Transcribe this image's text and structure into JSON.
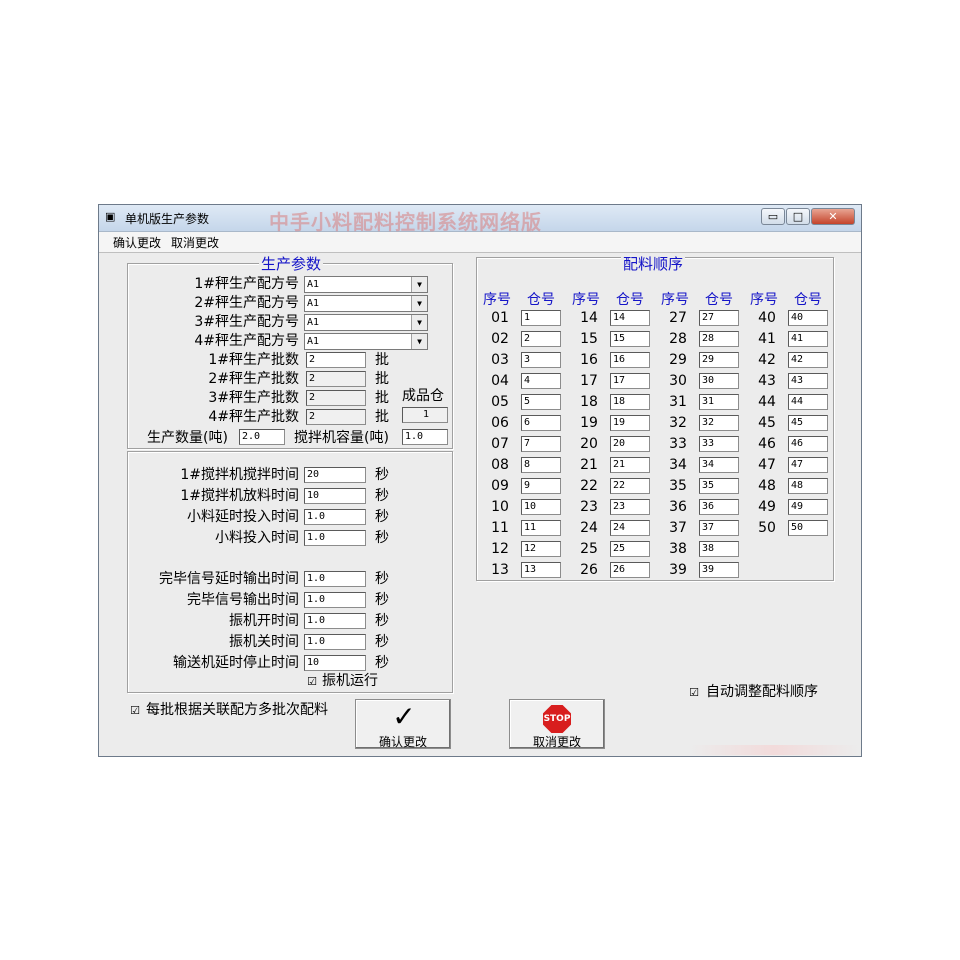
{
  "window": {
    "title": "单机版生产参数",
    "watermark": "中手小料配料控制系统网络版",
    "controls": {
      "minimize": "▭",
      "maximize": "□",
      "close": "✕"
    }
  },
  "menu": {
    "confirm": "确认更改",
    "cancel": "取消更改"
  },
  "production": {
    "title": "生产参数",
    "recipes": [
      {
        "label": "1#秤生产配方号",
        "value": "A1"
      },
      {
        "label": "2#秤生产配方号",
        "value": "A1"
      },
      {
        "label": "3#秤生产配方号",
        "value": "A1"
      },
      {
        "label": "4#秤生产配方号",
        "value": "A1"
      }
    ],
    "batches": [
      {
        "label": "1#秤生产批数",
        "value": "2",
        "unit": "批"
      },
      {
        "label": "2#秤生产批数",
        "value": "2",
        "unit": "批"
      },
      {
        "label": "3#秤生产批数",
        "value": "2",
        "unit": "批"
      },
      {
        "label": "4#秤生产批数",
        "value": "2",
        "unit": "批"
      }
    ],
    "finished_bin_label": "成品仓",
    "finished_bin_value": "1",
    "qty_label": "生产数量(吨)",
    "qty_value": "2.0",
    "mixer_cap_label": "搅拌机容量(吨)",
    "mixer_cap_value": "1.0"
  },
  "timing": {
    "rows_a": [
      {
        "label": "1#搅拌机搅拌时间",
        "value": "20",
        "unit": "秒"
      },
      {
        "label": "1#搅拌机放料时间",
        "value": "10",
        "unit": "秒"
      },
      {
        "label": "小料延时投入时间",
        "value": "1.0",
        "unit": "秒"
      },
      {
        "label": "小料投入时间",
        "value": "1.0",
        "unit": "秒"
      }
    ],
    "rows_b": [
      {
        "label": "完毕信号延时输出时间",
        "value": "1.0",
        "unit": "秒"
      },
      {
        "label": "完毕信号输出时间",
        "value": "1.0",
        "unit": "秒"
      },
      {
        "label": "振机开时间",
        "value": "1.0",
        "unit": "秒"
      },
      {
        "label": "振机关时间",
        "value": "1.0",
        "unit": "秒"
      },
      {
        "label": "输送机延时停止时间",
        "value": "10",
        "unit": "秒"
      }
    ],
    "vibrator_run_label": "振机运行",
    "vibrator_run_checked": "☑"
  },
  "multi_batch": {
    "label": "每批根据关联配方多批次配料",
    "checked": "☑"
  },
  "buttons": {
    "confirm": "确认更改",
    "cancel": "取消更改",
    "stop_text": "STOP",
    "check_glyph": "✓"
  },
  "sequence": {
    "title": "配料顺序",
    "header_seq": "序号",
    "header_bin": "仓号",
    "columns": [
      [
        [
          "01",
          "1"
        ],
        [
          "02",
          "2"
        ],
        [
          "03",
          "3"
        ],
        [
          "04",
          "4"
        ],
        [
          "05",
          "5"
        ],
        [
          "06",
          "6"
        ],
        [
          "07",
          "7"
        ],
        [
          "08",
          "8"
        ],
        [
          "09",
          "9"
        ],
        [
          "10",
          "10"
        ],
        [
          "11",
          "11"
        ],
        [
          "12",
          "12"
        ],
        [
          "13",
          "13"
        ]
      ],
      [
        [
          "14",
          "14"
        ],
        [
          "15",
          "15"
        ],
        [
          "16",
          "16"
        ],
        [
          "17",
          "17"
        ],
        [
          "18",
          "18"
        ],
        [
          "19",
          "19"
        ],
        [
          "20",
          "20"
        ],
        [
          "21",
          "21"
        ],
        [
          "22",
          "22"
        ],
        [
          "23",
          "23"
        ],
        [
          "24",
          "24"
        ],
        [
          "25",
          "25"
        ],
        [
          "26",
          "26"
        ]
      ],
      [
        [
          "27",
          "27"
        ],
        [
          "28",
          "28"
        ],
        [
          "29",
          "29"
        ],
        [
          "30",
          "30"
        ],
        [
          "31",
          "31"
        ],
        [
          "32",
          "32"
        ],
        [
          "33",
          "33"
        ],
        [
          "34",
          "34"
        ],
        [
          "35",
          "35"
        ],
        [
          "36",
          "36"
        ],
        [
          "37",
          "37"
        ],
        [
          "38",
          "38"
        ],
        [
          "39",
          "39"
        ]
      ],
      [
        [
          "40",
          "40"
        ],
        [
          "41",
          "41"
        ],
        [
          "42",
          "42"
        ],
        [
          "43",
          "43"
        ],
        [
          "44",
          "44"
        ],
        [
          "45",
          "45"
        ],
        [
          "46",
          "46"
        ],
        [
          "47",
          "47"
        ],
        [
          "48",
          "48"
        ],
        [
          "49",
          "49"
        ],
        [
          "50",
          "50"
        ]
      ]
    ]
  },
  "auto_adjust": {
    "label": "自动调整配料顺序",
    "checked": "☑"
  }
}
